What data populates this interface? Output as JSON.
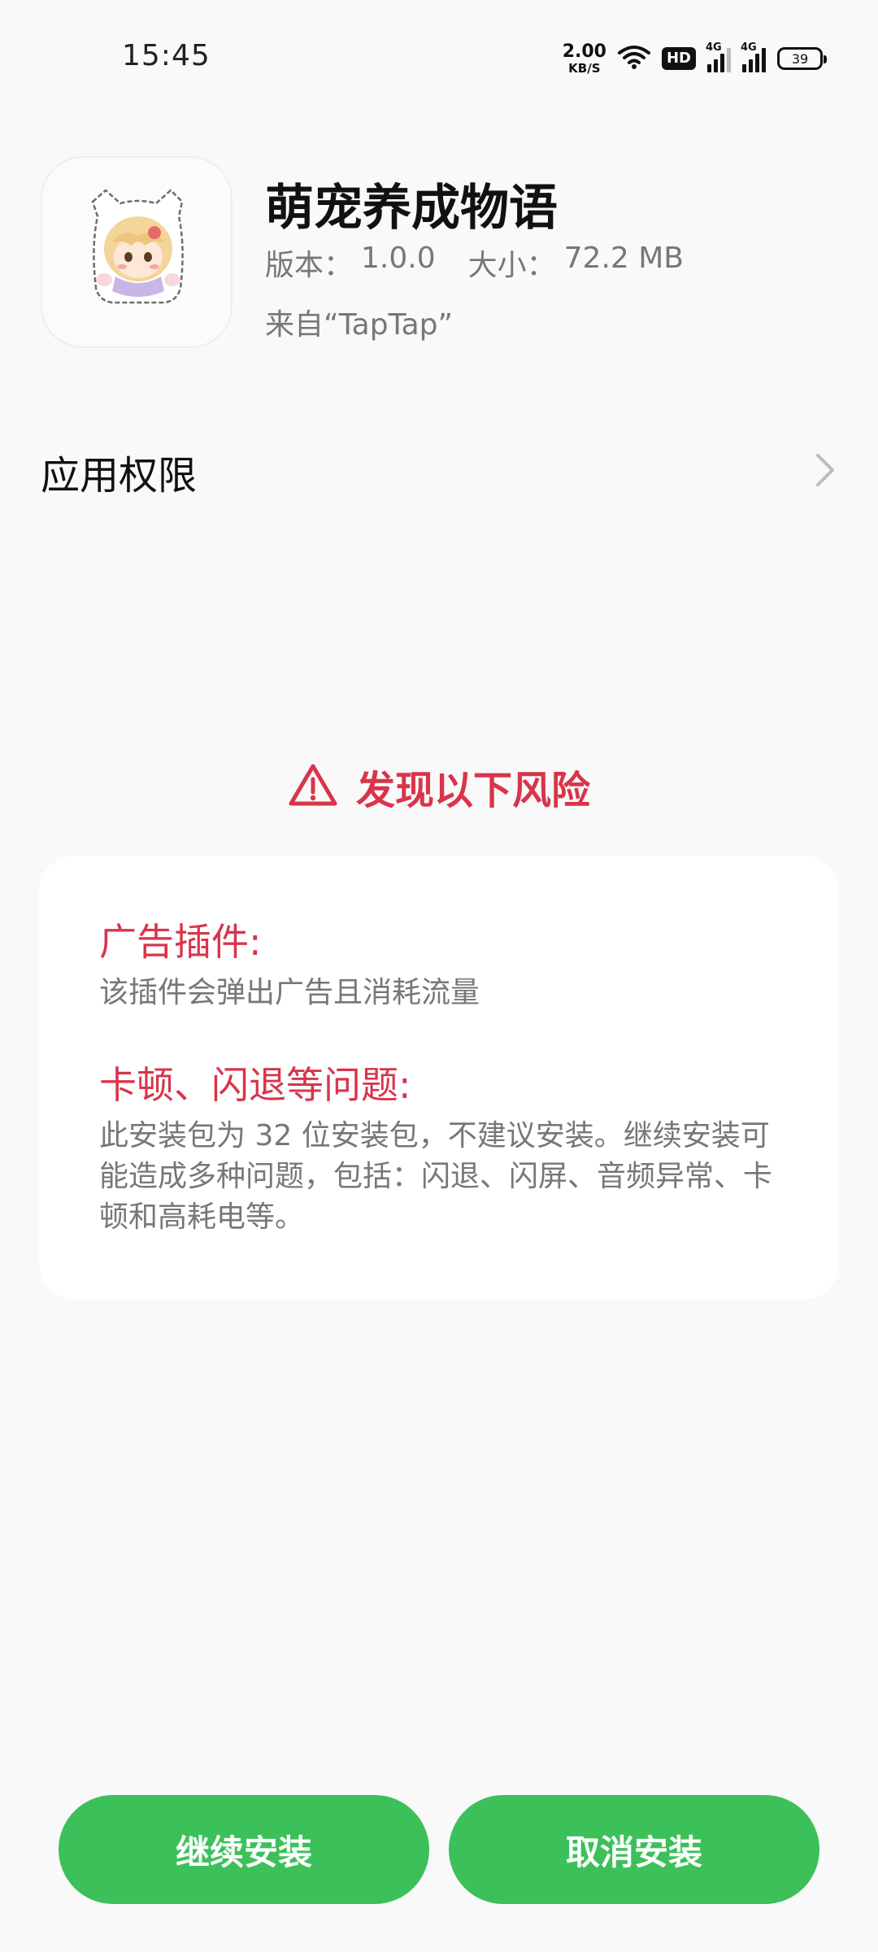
{
  "status_bar": {
    "time": "15:45",
    "net_speed_value": "2.00",
    "net_speed_unit": "KB/S",
    "hd_label": "HD",
    "signal1_label": "4G",
    "signal2_label": "4G",
    "battery_level": "39",
    "icons": [
      "wifi-icon",
      "hd-icon",
      "signal-icon",
      "signal-icon",
      "battery-icon"
    ]
  },
  "app": {
    "name": "萌宠养成物语",
    "version_label": "版本：",
    "version_value": "1.0.0",
    "size_label": "大小：",
    "size_value": "72.2 MB",
    "source": "来自“TapTap”",
    "icon": "app-icon"
  },
  "permissions": {
    "label": "应用权限",
    "icon": "chevron-right-icon"
  },
  "risk": {
    "title": "发现以下风险",
    "icon": "warning-icon",
    "color": "#d9344a",
    "items": [
      {
        "heading": "广告插件:",
        "description": "该插件会弹出广告且消耗流量"
      },
      {
        "heading": "卡顿、闪退等问题:",
        "description": "此安装包为 32 位安装包，不建议安装。继续安装可能造成多种问题，包括：闪退、闪屏、音频异常、卡顿和高耗电等。"
      }
    ]
  },
  "buttons": {
    "continue_label": "继续安装",
    "cancel_label": "取消安装",
    "color": "#3cc05a"
  }
}
